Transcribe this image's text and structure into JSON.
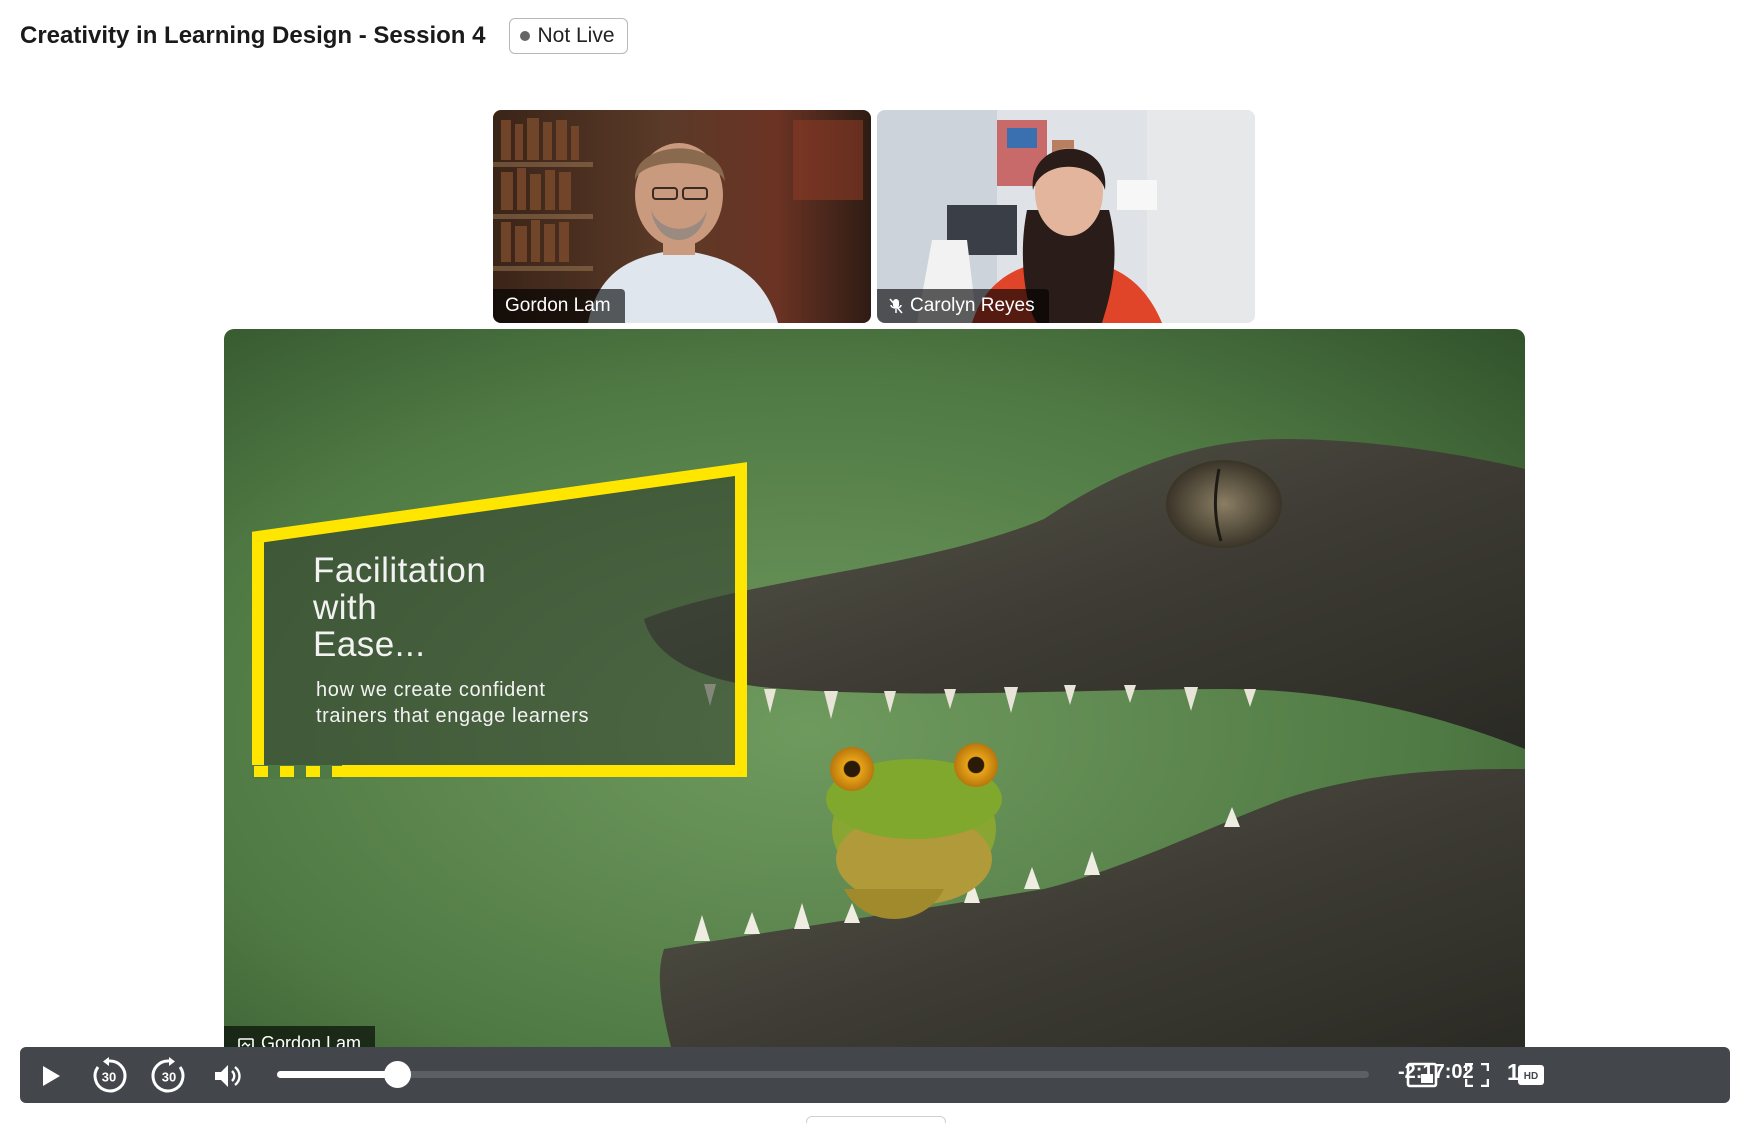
{
  "header": {
    "title": "Creativity in Learning Design - Session 4",
    "status_badge": "Not Live"
  },
  "participants": [
    {
      "name": "Gordon Lam",
      "muted": false
    },
    {
      "name": "Carolyn Reyes",
      "muted": true
    }
  ],
  "slide": {
    "title_lines": [
      "Facilitation",
      "with",
      "Ease..."
    ],
    "subtitle_lines": [
      "how we create confident",
      "trainers that engage learners"
    ]
  },
  "active_speaker": {
    "name": "Gordon Lam",
    "icon": "screen-share-icon"
  },
  "player": {
    "playback_progress": 0.11,
    "time_remaining": "-2:17:02",
    "speed": "1x",
    "rewind_label": "30",
    "forward_label": "30",
    "quality_badge": "HD",
    "icons": [
      "play-icon",
      "rewind-30-icon",
      "forward-30-icon",
      "volume-icon",
      "picture-in-picture-icon",
      "fullscreen-icon",
      "hd-icon"
    ]
  },
  "colors": {
    "slide_frame_yellow": "#ffe600",
    "controls_bar": "#43464b"
  }
}
